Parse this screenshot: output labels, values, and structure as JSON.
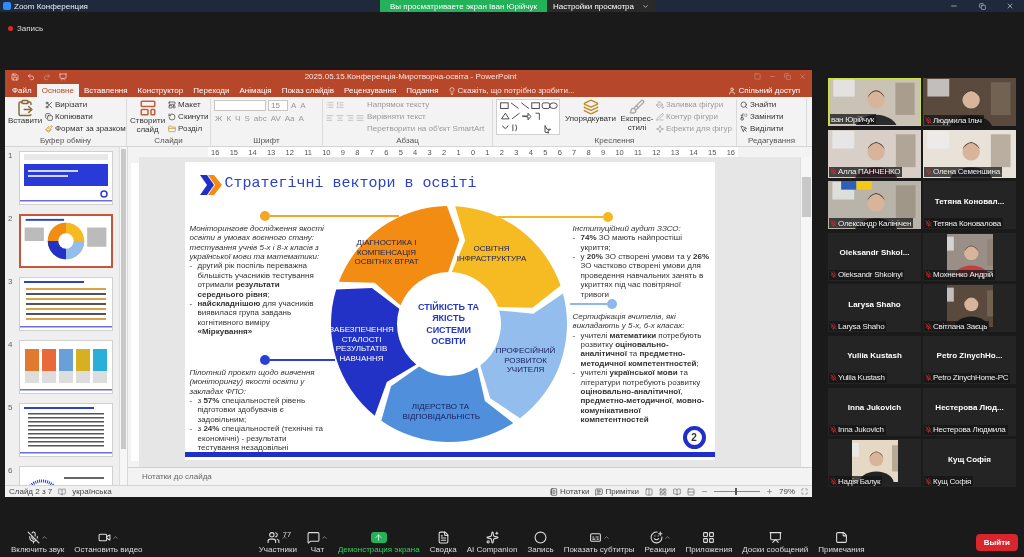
{
  "zoom_bar": {
    "app_title": "Zoom Конференция",
    "banner": "Вы просматриваете экран Іван Юрійчук",
    "view_options": "Настройки просмотра"
  },
  "recording": {
    "label": "Запись",
    "on": true
  },
  "powerpoint": {
    "title": "2025.05.15.Конференція-Миротворча-освіта - PowerPoint",
    "tabs": [
      {
        "label": "Файл",
        "selected": false
      },
      {
        "label": "Основне",
        "selected": true
      },
      {
        "label": "Вставлення",
        "selected": false
      },
      {
        "label": "Конструктор",
        "selected": false
      },
      {
        "label": "Переходи",
        "selected": false
      },
      {
        "label": "Анімація",
        "selected": false
      },
      {
        "label": "Показ слайдів",
        "selected": false
      },
      {
        "label": "Рецензування",
        "selected": false
      },
      {
        "label": "Подання",
        "selected": false
      }
    ],
    "tell_me": "Скажіть, що потрібно зробити...",
    "share": "Спільний доступ",
    "ribbon": {
      "clipboard": {
        "paste": "Вставити",
        "cut": "Вирізати",
        "copy": "Копіювати",
        "format_painter": "Формат за зразком",
        "label": "Буфер обміну"
      },
      "slides": {
        "new_slide": "Створити слайд",
        "layout": "Макет",
        "reset": "Скинути",
        "section": "Розділ",
        "label": "Слайди"
      },
      "font": {
        "size": "15",
        "row1": [
          "A",
          "A"
        ],
        "row2": [
          "Ж",
          "К",
          "Ч",
          "S",
          "abc",
          "AV",
          "Aa",
          "A"
        ],
        "label": "Шрифт"
      },
      "paragraph": {
        "items": [
          {
            "label": "Напрямок тексту",
            "disabled": true
          },
          {
            "label": "Вирівняти текст",
            "disabled": true
          },
          {
            "label": "Перетворити на об'єкт SmartArt",
            "disabled": true
          }
        ],
        "label": "Абзац"
      },
      "drawing": {
        "arrange": "Упорядкувати",
        "quick_styles": "Експрес-стилі",
        "items": [
          {
            "label": "Заливка фігури",
            "disabled": true
          },
          {
            "label": "Контур фігури",
            "disabled": true
          },
          {
            "label": "Ефекти для фігур",
            "disabled": true
          }
        ],
        "label": "Креслення"
      },
      "editing": {
        "items": [
          "Знайти",
          "Замінити",
          "Виділити"
        ],
        "label": "Редагування"
      }
    },
    "ruler": [
      "16",
      "15",
      "14",
      "13",
      "12",
      "11",
      "10",
      "9",
      "8",
      "7",
      "6",
      "5",
      "4",
      "3",
      "2",
      "1",
      "0",
      "1",
      "2",
      "3",
      "4",
      "5",
      "6",
      "7",
      "8",
      "9",
      "10",
      "11",
      "12",
      "13",
      "14",
      "15",
      "16"
    ],
    "thumbnails": [
      {
        "number": "1",
        "selected": false
      },
      {
        "number": "2",
        "selected": true
      },
      {
        "number": "3",
        "selected": false
      },
      {
        "number": "4",
        "selected": false
      },
      {
        "number": "5",
        "selected": false
      },
      {
        "number": "6",
        "selected": false
      }
    ],
    "slide": {
      "title": "Стратегічні вектори в освіті",
      "center": "СТІЙКІСТЬ ТА ЯКІСТЬ СИСТЕМИ ОСВІТИ",
      "segments": [
        {
          "label": "ДІАГНОСТИКА І КОМПЕНСАЦІЯ ОСВІТНІХ ВТРАТ",
          "color": "#f28c12"
        },
        {
          "label": "ОСВІТНЯ ІНФРАСТРУКТУРА",
          "color": "#f6bb22"
        },
        {
          "label": "ПРОФЕСІЙНИЙ РОЗВИТОК УЧИТЕЛЯ",
          "color": "#93bdec"
        },
        {
          "label": "ЛІДЕРСТВО ТА ВІДПОВІДАЛЬНІСТЬ",
          "color": "#4f8fdc"
        },
        {
          "label": "ЗАБЕЗПЕЧЕННЯ СТАЛОСТІ РЕЗУЛЬТАТІВ НАВЧАННЯ",
          "color": "#2232c6"
        }
      ],
      "callouts": [
        {
          "color": "#f5a623",
          "intro": "Моніторингове дослідження якості освіти в умовах воєнного стану: тестування учнів 5-х і 8-х класів з української мови та математики:",
          "marker": "-",
          "bullets": [
            "другий рік поспіль переважна більшість учасників тестування отримали **результати середнього рівня**;",
            "**найскладнішою** для учасників виявилася група завдань когнітивного виміру **«Міркування»**"
          ]
        },
        {
          "color": "#2a3fd6",
          "intro": "Пілотний проєкт щодо вивчення (моніторингу) якості освіти у закладах ФПО:",
          "marker": "-",
          "bullets": [
            "з **57%** спеціальностей рівень підготовки здобувачів є задовільним;",
            "з **24%** спеціальностей (технічні та економічні) - результати тестування незадовільні"
          ]
        },
        {
          "color": "#f5b820",
          "intro": "Інституційний аудит ЗЗСО:",
          "marker": "-",
          "bullets": [
            "**74%** ЗО мають найпростіші укриття;",
            "у **20%** ЗО створені умови та у **26%** ЗО частково створені умови для проведення навчальних занять в укриттях під час повітряної тривоги"
          ]
        },
        {
          "color": "#8fb8ea",
          "intro": "Сертифікація вчителів, які викладають у 5-х, 6-х класах:",
          "marker": "-",
          "bullets": [
            "учителі **математики** потребують розвитку **оціновально-аналітичної** та **предметно-методичної компетентностей**;",
            "учителі **української мови** та літератури потребують розвитку **оціновально-аналітичної**, **предметно-методичної**, **мовно-комунікативної компетентностей**"
          ]
        }
      ],
      "page_number": "2"
    },
    "notes_placeholder": "Нотатки до слайда",
    "status": {
      "slide": "Слайд 2 з 7",
      "language": "українська",
      "notes": "Нотатки",
      "comments": "Примітки",
      "zoom_slider": {
        "level": 0.45
      },
      "zoom": "79%"
    }
  },
  "participants": [
    {
      "name": "ван Юрійчук",
      "kind": "video",
      "muted": false,
      "speaking": true
    },
    {
      "name": "Людмила Ільч",
      "kind": "video",
      "muted": true,
      "speaking": false
    },
    {
      "name": "Алла ПАНЧЕНКО",
      "kind": "video",
      "muted": true,
      "speaking": false
    },
    {
      "name": "Олена Семеншина",
      "kind": "video",
      "muted": true,
      "speaking": false
    },
    {
      "name": "Олександр Калінічен",
      "kind": "video",
      "muted": true,
      "speaking": false
    },
    {
      "name": "Тетяна Коновалова",
      "display_name": "Тетяна Коновал...",
      "kind": "name",
      "muted": true,
      "speaking": false
    },
    {
      "name": "Oleksandr Shkolnyi",
      "display_name": "Oleksandr Shkol...",
      "kind": "name",
      "muted": true,
      "speaking": false
    },
    {
      "name": "Мохненко Андрій",
      "kind": "portrait",
      "muted": true,
      "speaking": false
    },
    {
      "name": "Larysa Shaho",
      "display_name": "Larysa Shaho",
      "kind": "name",
      "muted": true,
      "speaking": false
    },
    {
      "name": "Світлана Заєць",
      "kind": "portrait",
      "muted": true,
      "speaking": false
    },
    {
      "name": "Yuliia Kustash",
      "display_name": "Yuliia Kustash",
      "kind": "name",
      "muted": true,
      "speaking": false
    },
    {
      "name": "Petro ZinychHome-PC",
      "display_name": "Petro ZinychHo...",
      "kind": "name",
      "muted": true,
      "speaking": false
    },
    {
      "name": "Inna Jukovich",
      "display_name": "Inna Jukovich",
      "kind": "name",
      "muted": true,
      "speaking": false
    },
    {
      "name": "Нестерова Людмила",
      "display_name": "Нестерова Люд...",
      "kind": "name",
      "muted": true,
      "speaking": false
    },
    {
      "name": "Надія Балук",
      "kind": "portrait",
      "muted": true,
      "speaking": false
    },
    {
      "name": "Кущ Софія",
      "display_name": "Кущ Софія",
      "kind": "name",
      "muted": true,
      "speaking": false
    }
  ],
  "toolbar_left": [
    {
      "kind": "mic_off",
      "label": "Включить звук",
      "caret": true,
      "active": false
    },
    {
      "kind": "video",
      "label": "Остановить видео",
      "caret": true,
      "active": false
    }
  ],
  "toolbar": [
    {
      "kind": "participants",
      "label": "Участники",
      "count": "77",
      "caret": true,
      "active": false
    },
    {
      "kind": "chat",
      "label": "Чат",
      "caret": true,
      "active": false
    },
    {
      "kind": "share",
      "label": "Демонстрация экрана",
      "caret": false,
      "active": true
    },
    {
      "kind": "summary",
      "label": "Сводка",
      "caret": false,
      "active": false
    },
    {
      "kind": "ai",
      "label": "AI Companion",
      "caret": false,
      "active": false
    },
    {
      "kind": "record",
      "label": "Запись",
      "caret": false,
      "active": false
    },
    {
      "kind": "captions",
      "label": "Показать субтитры",
      "caret": true,
      "active": false
    },
    {
      "kind": "reactions",
      "label": "Реакции",
      "caret": true,
      "active": false
    },
    {
      "kind": "apps",
      "label": "Приложения",
      "caret": false,
      "active": false
    },
    {
      "kind": "boards",
      "label": "Доски сообщений",
      "caret": false,
      "active": false
    },
    {
      "kind": "notes",
      "label": "Примечания",
      "caret": false,
      "active": false
    }
  ],
  "leave": "Выйти"
}
